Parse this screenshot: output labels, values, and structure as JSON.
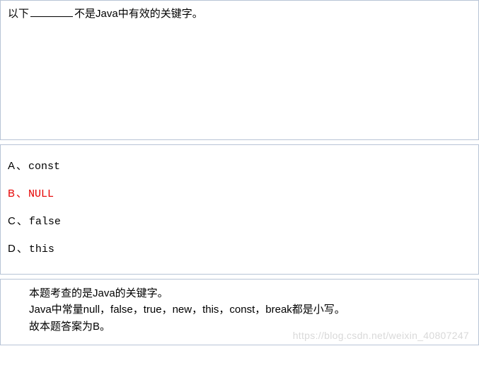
{
  "question": {
    "prefix": "以下",
    "suffix": "不是Java中有效的关键字。"
  },
  "options": [
    {
      "label": "A",
      "sep": "、",
      "text": "const",
      "correct": false
    },
    {
      "label": "B",
      "sep": "、",
      "text": "NULL",
      "correct": true
    },
    {
      "label": "C",
      "sep": "、",
      "text": "false",
      "correct": false
    },
    {
      "label": "D",
      "sep": "、",
      "text": "this",
      "correct": false
    }
  ],
  "explanation": {
    "line1": "本题考查的是Java的关键字。",
    "line2": "Java中常量null，false，true，new，this，const，break都是小写。",
    "line3": "故本题答案为B。"
  },
  "watermark": "https://blog.csdn.net/weixin_40807247"
}
